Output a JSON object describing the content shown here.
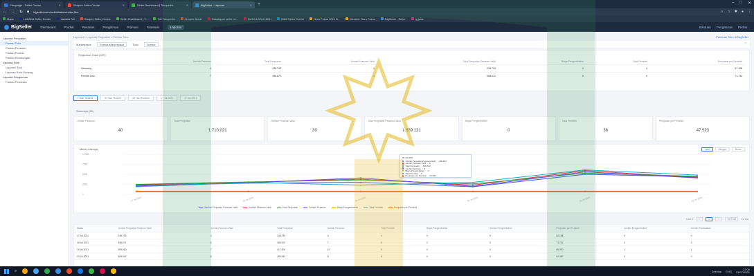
{
  "browser": {
    "tabs": [
      {
        "label": "Campaign - Seller Center",
        "color": "#3a7bd5",
        "active": false
      },
      {
        "label": "Shopee Seller Centre",
        "color": "#ee4d2d",
        "active": false
      },
      {
        "label": "Seller Dashboard | Tokopedia",
        "color": "#42b549",
        "active": false
      },
      {
        "label": "BigSeller - Laporan",
        "color": "#3a8dde",
        "active": true
      }
    ],
    "new_tab": "+",
    "url": "bigseller.com/web/data/overview.htm",
    "bookmarks": [
      {
        "label": "Maps",
        "color": "#34a853"
      },
      {
        "label": "LAZADA Seller Center",
        "color": "#1a237e"
      },
      {
        "label": "Lazada Toll",
        "color": "#1a237e"
      },
      {
        "label": "Shopee Seller Centre",
        "color": "#ee4d2d"
      },
      {
        "label": "Seller Dashboard | T...",
        "color": "#42b549"
      },
      {
        "label": "Toll Tokopedia",
        "color": "#42b549"
      },
      {
        "label": "Shopee Buyer",
        "color": "#ee4d2d"
      },
      {
        "label": "Bukalapak seller ce...",
        "color": "#d71149"
      },
      {
        "label": "BUKA LAPAK BELI",
        "color": "#d71149"
      },
      {
        "label": "Blibli Seller Center",
        "color": "#0095da"
      },
      {
        "label": "Guru Fokus 2021 B...",
        "color": "#f6a800"
      },
      {
        "label": "Member Guru Fokus",
        "color": "#f6a800"
      },
      {
        "label": "BigSeller - Seller",
        "color": "#3a8dde"
      },
      {
        "label": "ig jaha",
        "color": "#c13584"
      }
    ]
  },
  "app": {
    "logo": "BigSeller",
    "nav": [
      "Dashboard",
      "Produk",
      "Pesanan",
      "Pengiriman",
      "Promosi",
      "Finansial",
      "Laporan"
    ],
    "active_nav": "Laporan",
    "right_links": [
      "Bantuan",
      "Pengaturan",
      "Perbar..."
    ]
  },
  "sidebar": {
    "items": [
      {
        "label": "Laporan Penjualan",
        "kind": "group",
        "active": true
      },
      {
        "label": "Pantau Toko",
        "kind": "item",
        "active": true
      },
      {
        "label": "Pantau Pesanan",
        "kind": "item",
        "active": false
      },
      {
        "label": "Pantau Produk",
        "kind": "item",
        "active": false
      },
      {
        "label": "Pantau Keuntungan",
        "kind": "item",
        "active": false
      },
      {
        "label": "Laporan Stok",
        "kind": "group",
        "active": false
      },
      {
        "label": "Laporan Stok",
        "kind": "item",
        "active": false
      },
      {
        "label": "Laporan Stok Gudang",
        "kind": "item",
        "active": false
      },
      {
        "label": "Laporan Pengiriman",
        "kind": "group",
        "active": false
      },
      {
        "label": "Pantau Pemesan",
        "kind": "item",
        "active": false
      }
    ]
  },
  "main": {
    "breadcrumb": "Laporan > Laporan Penjualan > Pantau Toko",
    "help_link": "Panduan Toko di BigSeller",
    "filters": {
      "label": "Marketplace",
      "marketplace": "Semua Marketplace",
      "toko_label": "Toko",
      "toko": "Semua"
    },
    "top_table": {
      "title": "Ringkasan Hasil (IDR)",
      "headers": [
        "",
        "Jumlah Pesanan",
        "Total Penjualan",
        "Jumlah Pesanan Valid",
        "Total Penjualan Pesanan Valid",
        "Biaya Pengembalian",
        "Total Pembeli",
        "Penjualan per Pembeli"
      ],
      "rows": [
        [
          "Sekarang",
          "4",
          "228.793",
          "4",
          "228.793",
          "0",
          "4",
          "57.198"
        ],
        [
          "Periode Lalu",
          "7",
          "358.672",
          "6",
          "358.672",
          "0",
          "5",
          "71.734"
        ]
      ]
    },
    "period_tabs": [
      "7 Hari Terakhir",
      "30 Hari Terakhir",
      "60 Hari Terakhir",
      "17 Jul 2021",
      "17 Jul 2021"
    ],
    "summary": {
      "title": "Summary (ID)",
      "cards": [
        {
          "label": "Jumlah Pesanan",
          "value": "40"
        },
        {
          "label": "Total Penjualan",
          "value": "1.710.021"
        },
        {
          "label": "Jumlah Pesanan Valid",
          "value": "39"
        },
        {
          "label": "Total Penjualan Pesanan Valid",
          "value": "1.639.121"
        },
        {
          "label": "Biaya Pengembalian",
          "value": "0"
        },
        {
          "label": "Total Pembeli",
          "value": "36"
        },
        {
          "label": "Penjualan per Pembeli",
          "value": "47.523"
        }
      ]
    },
    "chart": {
      "title": "Metric Lainnya",
      "toggle": [
        "Hari",
        "Minggu",
        "Bulan"
      ],
      "tooltip": {
        "date": "20 Jul 2021",
        "rows": [
          {
            "label": "Jumlah Penjualan Pesanan Valid",
            "value": "499.842",
            "color": "#3b5bdb"
          },
          {
            "label": "Jumlah Pesanan Valid",
            "value": "8",
            "color": "#e03131"
          },
          {
            "label": "Total Penjualan",
            "value": "499.842",
            "color": "#2f9e44"
          },
          {
            "label": "Jumlah Pesanan",
            "value": "8",
            "color": "#7048e8"
          },
          {
            "label": "Biaya Pengembalian",
            "value": "0",
            "color": "#f59f00"
          },
          {
            "label": "Total Pembeli",
            "value": "8",
            "color": "#1098ad"
          },
          {
            "label": "Penjualan per Pembeli",
            "value": "62.480",
            "color": "#e8590c"
          }
        ]
      }
    },
    "pager": {
      "total": "Total 5",
      "page": "1",
      "prev": "<",
      "next": ">",
      "per_page": "10 / hal",
      "goto": "Ke Hal"
    },
    "bottom_table": {
      "headers": [
        "Waktu",
        "Jumlah Penjualan Pesanan Valid",
        "Jumlah Pesanan Valid",
        "Total Penjualan",
        "Jumlah Pesanan",
        "Total Pembeli",
        "Biaya Pengembalian",
        "Jumlah Pengembalian",
        "Penjualan per Pembeli",
        "Jumlah Pengembalian",
        "Jumlah Pembatalan"
      ],
      "rows": [
        [
          "17 Jul 2021",
          "248.793",
          "4",
          "248.793",
          "4",
          "4",
          "0",
          "0",
          "62.198",
          "0",
          "0"
        ],
        [
          "18 Jul 2021",
          "358.672",
          "6",
          "358.672",
          "7",
          "5",
          "0",
          "0",
          "71.734",
          "0",
          "0"
        ],
        [
          "19 Jul 2021",
          "399.000",
          "7",
          "417.000",
          "10",
          "6",
          "0",
          "0",
          "66.500",
          "1",
          "1"
        ],
        [
          "20 Jul 2021",
          "499.842",
          "8",
          "499.842",
          "8",
          "8",
          "0",
          "0",
          "62.480",
          "0",
          "0"
        ]
      ]
    }
  },
  "chart_data": {
    "type": "line",
    "categories": [
      "17 Jul 2021",
      "18 Jul 2021",
      "19 Jul 2021",
      "20 Jul 2021",
      "21 Jul 2021",
      "22 Jul 2021"
    ],
    "ylim": [
      0,
      1000000
    ],
    "y_ticks": [
      "0",
      "250k",
      "500k",
      "750k",
      "1.000k"
    ],
    "series": [
      {
        "name": "Jumlah Penjualan Pesanan Valid",
        "color": "#3b5bdb",
        "values": [
          220000,
          280000,
          300000,
          190000,
          500000,
          440000
        ]
      },
      {
        "name": "Jumlah Pesanan Valid",
        "color": "#e03131",
        "values": [
          240000,
          300000,
          380000,
          230000,
          590000,
          420000
        ]
      },
      {
        "name": "Total Penjualan",
        "color": "#2f9e44",
        "values": [
          250000,
          310000,
          360000,
          260000,
          530000,
          450000
        ]
      },
      {
        "name": "Jumlah Pesanan",
        "color": "#7048e8",
        "values": [
          200000,
          290000,
          410000,
          200000,
          560000,
          410000
        ]
      },
      {
        "name": "Biaya Pengembalian",
        "color": "#f59f00",
        "values": [
          60000,
          60000,
          60000,
          60000,
          60000,
          60000
        ]
      },
      {
        "name": "Total Pembeli",
        "color": "#15aabf",
        "values": [
          190000,
          300000,
          230000,
          300000,
          610000,
          480000
        ]
      },
      {
        "name": "Penjualan per Pembeli",
        "color": "#e8590c",
        "values": [
          80000,
          80000,
          80000,
          80000,
          80000,
          80000
        ]
      }
    ]
  },
  "taskbar": {
    "apps": [
      "#f6a800",
      "#4aa3ff",
      "#34a853",
      "#3a8dde",
      "#ee4d2d",
      "#1a73e8",
      "#42b549",
      "#d71149",
      "#fbbc04"
    ],
    "right_text": "Desktop",
    "lang": "ENG",
    "time": "22:06",
    "date": "22/07/2021"
  }
}
